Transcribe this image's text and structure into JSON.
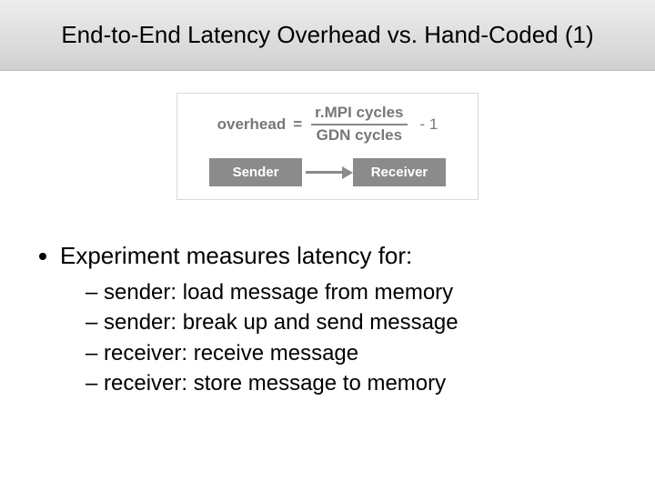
{
  "title": "End-to-End Latency Overhead vs. Hand-Coded (1)",
  "formula": {
    "lhs": "overhead",
    "eq": "=",
    "numerator": "r.MPI cycles",
    "denominator": "GDN cycles",
    "trailing": "- 1"
  },
  "diagram": {
    "sender": "Sender",
    "receiver": "Receiver"
  },
  "bullet": "Experiment measures latency for:",
  "sub_bullets": [
    "sender: load message from memory",
    "sender: break up and send message",
    "receiver: receive message",
    "receiver: store message to memory"
  ]
}
